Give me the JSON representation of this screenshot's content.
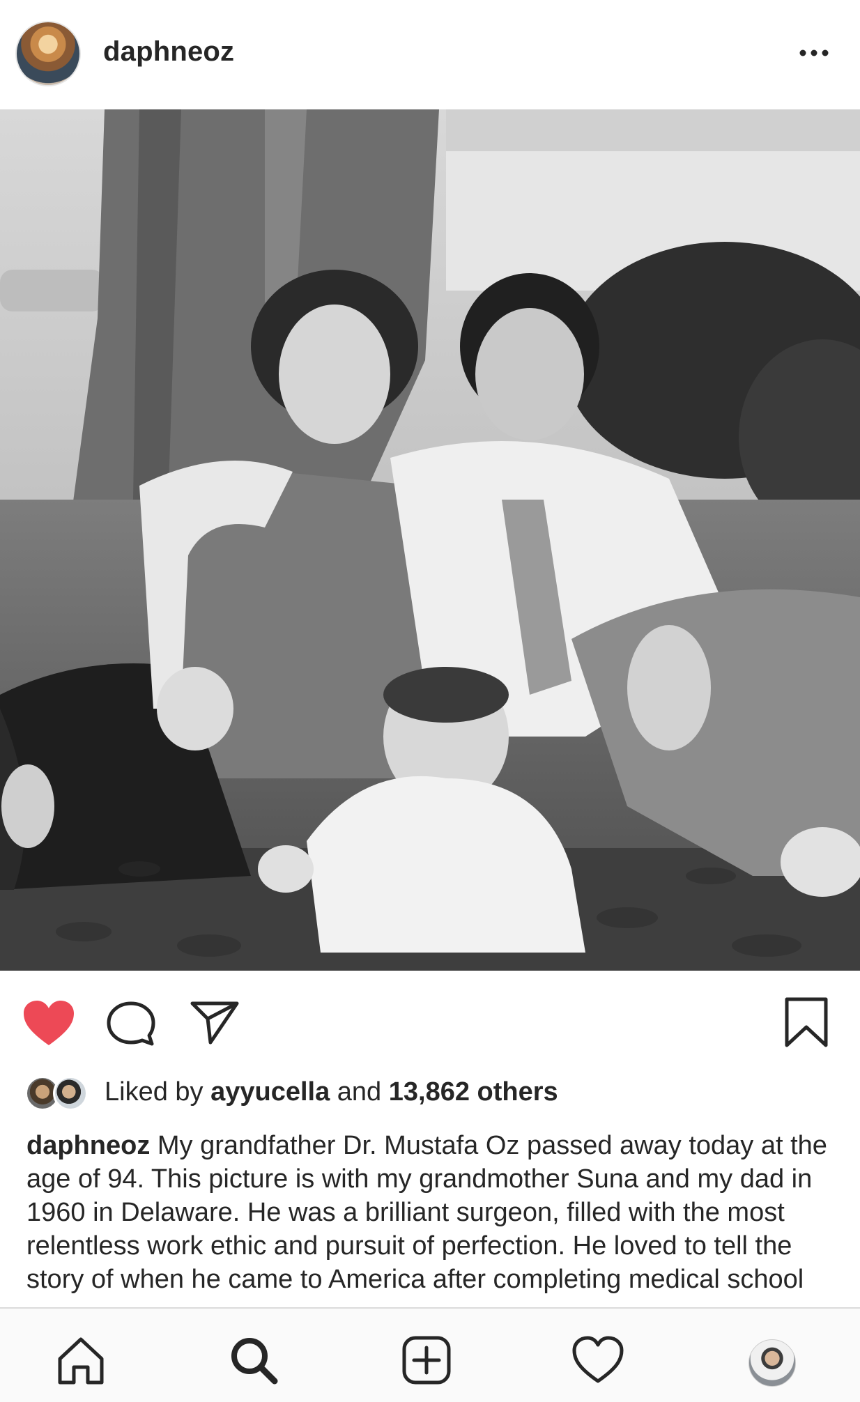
{
  "post": {
    "username": "daphneoz",
    "photo_alt": "",
    "liked": true
  },
  "likes": {
    "prefix": "Liked by ",
    "liker": "ayyucella",
    "middle": " and ",
    "count": "13,862 others"
  },
  "caption": {
    "username": "daphneoz",
    "text": " My grandfather Dr. Mustafa Oz passed away today at the age of 94. This picture is with my grandmother Suna and my dad in 1960 in Delaware. He was a brilliant surgeon, filled with the most relentless work ethic and pursuit of perfection. He loved to tell the story of when he came to America after completing medical school as a"
  },
  "icons": {
    "more": "more-horizontal-icon",
    "like": "heart-filled-icon",
    "comment": "comment-icon",
    "share": "send-icon",
    "save": "bookmark-icon",
    "nav_home": "home-icon",
    "nav_search": "search-icon",
    "nav_add": "add-post-icon",
    "nav_activity": "heart-outline-icon"
  },
  "colors": {
    "like_red": "#ed4956",
    "text": "#262626"
  }
}
